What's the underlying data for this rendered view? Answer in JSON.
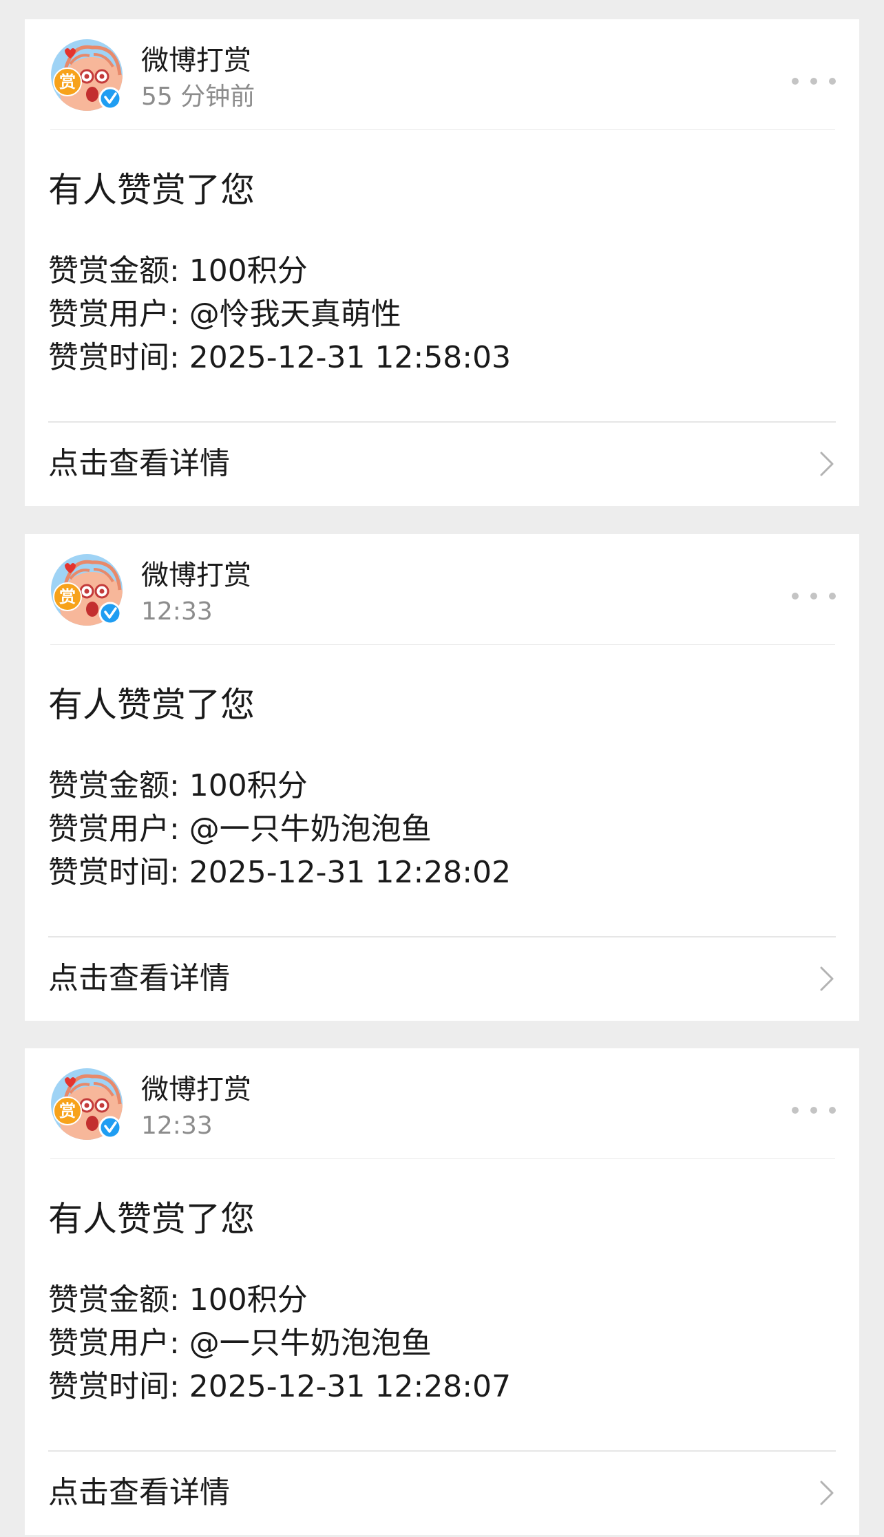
{
  "colors": {
    "background": "#ededed",
    "card": "#ffffff",
    "primary_text": "#1a1a1a",
    "secondary_text": "#8c8c8c",
    "divider": "#e6e6e6",
    "verified_badge": "#1f9df2",
    "reward_badge": "#f7a21b"
  },
  "icons": {
    "avatar": "weibo-reward-mascot-avatar",
    "verified": "verified-badge-icon",
    "reward_mark": "赏",
    "more": "more-dots-icon",
    "chevron": "chevron-right-icon"
  },
  "messages": [
    {
      "sender": "微博打赏",
      "time": "55 分钟前",
      "title": "有人赞赏了您",
      "amount_line": "赞赏金额: 100积分",
      "user_line": "赞赏用户: @怜我天真萌性",
      "time_line": "赞赏时间: 2025-12-31 12:58:03",
      "link_label": "点击查看详情"
    },
    {
      "sender": "微博打赏",
      "time": "12:33",
      "title": "有人赞赏了您",
      "amount_line": "赞赏金额: 100积分",
      "user_line": "赞赏用户: @一只牛奶泡泡鱼",
      "time_line": "赞赏时间: 2025-12-31 12:28:02",
      "link_label": "点击查看详情"
    },
    {
      "sender": "微博打赏",
      "time": "12:33",
      "title": "有人赞赏了您",
      "amount_line": "赞赏金额: 100积分",
      "user_line": "赞赏用户: @一只牛奶泡泡鱼",
      "time_line": "赞赏时间: 2025-12-31 12:28:07",
      "link_label": "点击查看详情"
    }
  ]
}
